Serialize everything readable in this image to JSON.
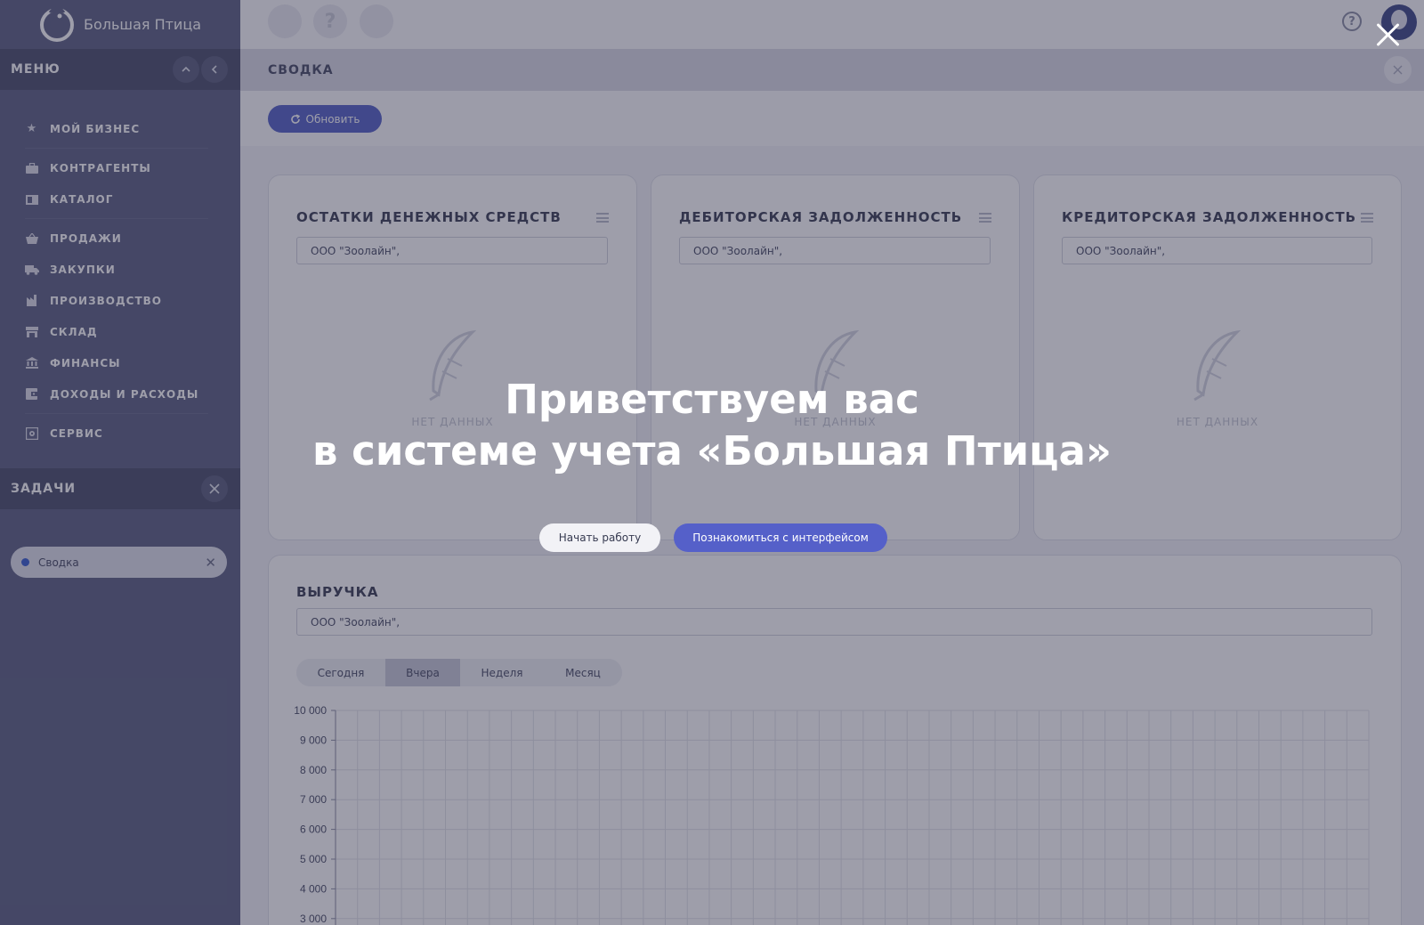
{
  "brand": {
    "name": "Большая Птица",
    "logo_icon": "bird-logo-icon"
  },
  "menu": {
    "header": "МЕНЮ",
    "items": [
      {
        "label": "МОЙ БИЗНЕС",
        "icon": "star-icon"
      },
      {
        "label": "КОНТРАГЕНТЫ",
        "icon": "briefcase-icon"
      },
      {
        "label": "КАТАЛОГ",
        "icon": "book-icon"
      },
      {
        "label": "ПРОДАЖИ",
        "icon": "basket-icon"
      },
      {
        "label": "ЗАКУПКИ",
        "icon": "truck-icon"
      },
      {
        "label": "ПРОИЗВОДСТВО",
        "icon": "factory-icon"
      },
      {
        "label": "СКЛАД",
        "icon": "warehouse-icon"
      },
      {
        "label": "ФИНАНСЫ",
        "icon": "bank-icon"
      },
      {
        "label": "ДОХОДЫ И РАСХОДЫ",
        "icon": "wallet-icon"
      },
      {
        "label": "СЕРВИС",
        "icon": "gear-box-icon"
      }
    ]
  },
  "tasks": {
    "header": "ЗАДАЧИ",
    "items": [
      {
        "label": "Сводка",
        "color": "#3a5fd0"
      }
    ]
  },
  "topbar": {
    "help_glyph": "?"
  },
  "tab": {
    "title": "СВОДКА"
  },
  "toolbar": {
    "refresh_label": "Обновить"
  },
  "cards": [
    {
      "title": "ОСТАТКИ ДЕНЕЖНЫХ СРЕДСТВ",
      "org": "ООО \"Зоолайн\",",
      "empty_text": "НЕТ ДАННЫХ"
    },
    {
      "title": "ДЕБИТОРСКАЯ ЗАДОЛЖЕННОСТЬ",
      "org": "ООО \"Зоолайн\",",
      "empty_text": "НЕТ ДАННЫХ"
    },
    {
      "title": "КРЕДИТОРСКАЯ ЗАДОЛЖЕННОСТЬ",
      "org": "ООО \"Зоолайн\",",
      "empty_text": "НЕТ ДАННЫХ"
    }
  ],
  "revenue": {
    "title": "ВЫРУЧКА",
    "org": "ООО \"Зоолайн\",",
    "periods": [
      "Сегодня",
      "Вчера",
      "Неделя",
      "Месяц"
    ],
    "active_period": "Вчера"
  },
  "chart_data": {
    "type": "line",
    "title": "",
    "xlabel": "",
    "ylabel": "",
    "ylim": [
      3000,
      10000
    ],
    "yticks": [
      10000,
      9000,
      8000,
      7000,
      6000,
      5000,
      4000,
      3000
    ],
    "ytick_labels": [
      "10 000",
      "9 000",
      "8 000",
      "7 000",
      "6 000",
      "5 000",
      "4 000",
      "3 000"
    ],
    "grid": true,
    "series": []
  },
  "welcome": {
    "line1": "Приветствуем вас",
    "line2": "в системе учета «Большая Птица»",
    "start_label": "Начать работу",
    "tour_label": "Познакомиться с интерфейсом"
  },
  "colors": {
    "sidebar": "#5d6283",
    "accent": "#5763c7",
    "overlay": "rgba(40,40,66,0.45)"
  }
}
